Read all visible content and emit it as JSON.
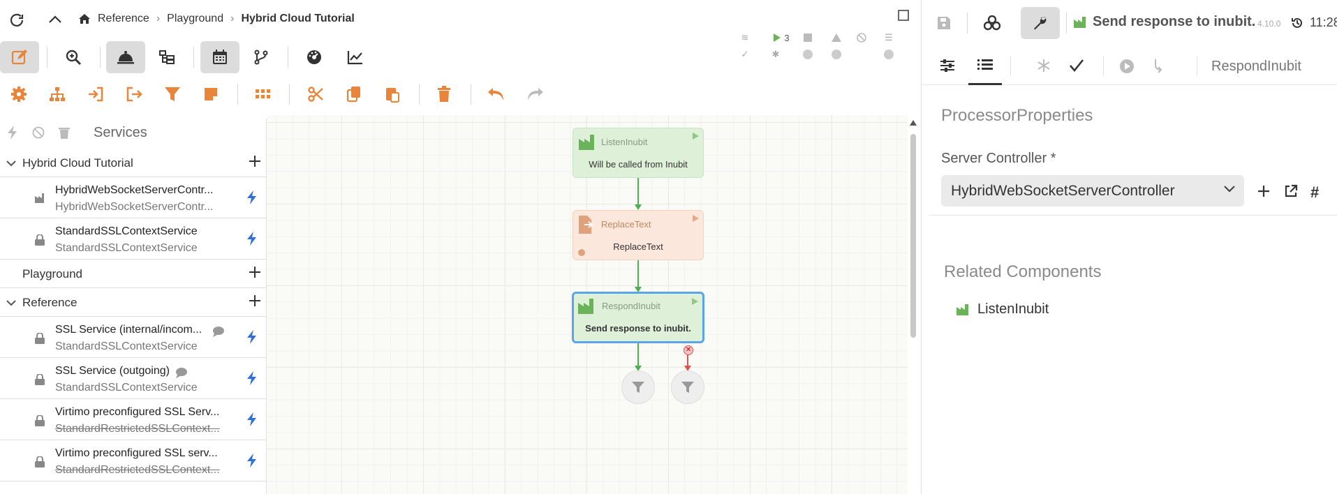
{
  "breadcrumb": {
    "items": [
      "Reference",
      "Playground",
      "Hybrid Cloud Tutorial"
    ]
  },
  "status": {
    "running_count": "3"
  },
  "services": {
    "title": "Services",
    "groups": [
      {
        "name": "Hybrid Cloud Tutorial",
        "expanded": true,
        "items": [
          {
            "name": "HybridWebSocketServerContr...",
            "type": "HybridWebSocketServerContr...",
            "icon": "factory-icon"
          },
          {
            "name": "StandardSSLContextService",
            "type": "StandardSSLContextService",
            "icon": "lock-icon"
          }
        ]
      },
      {
        "name": "Playground",
        "expanded": false,
        "items": []
      },
      {
        "name": "Reference",
        "expanded": true,
        "items": [
          {
            "name": "SSL Service (internal/incom...",
            "type": "StandardSSLContextService",
            "icon": "lock-icon",
            "comment": true
          },
          {
            "name": "SSL Service (outgoing)",
            "type": "StandardSSLContextService",
            "icon": "lock-icon",
            "comment": true
          },
          {
            "name": "Virtimo preconfigured SSL Serv...",
            "type": "StandardRestrictedSSLContext...",
            "icon": "lock-icon",
            "strike": true
          },
          {
            "name": "Virtimo preconfigured SSL serv...",
            "type": "StandardRestrictedSSLContext...",
            "icon": "lock-icon",
            "strike": true
          }
        ]
      }
    ]
  },
  "flow": {
    "nodes": [
      {
        "name": "ListenInubit",
        "description": "Will be called from Inubit"
      },
      {
        "name": "ReplaceText",
        "description": "ReplaceText"
      },
      {
        "name": "RespondInubit",
        "description": "Send response to inubit."
      }
    ]
  },
  "right": {
    "title": "Send response to inubit.",
    "version": "4.10.0",
    "time": "11:28",
    "component_name": "RespondInubit",
    "section_title": "ProcessorProperties",
    "server_controller_label": "Server Controller *",
    "server_controller_value": "HybridWebSocketServerController",
    "related_title": "Related Components",
    "related": [
      "ListenInubit"
    ]
  },
  "colors": {
    "accent_orange": "#e8853a",
    "green": "#6bb35a",
    "bolt_blue": "#2f6fd6"
  }
}
